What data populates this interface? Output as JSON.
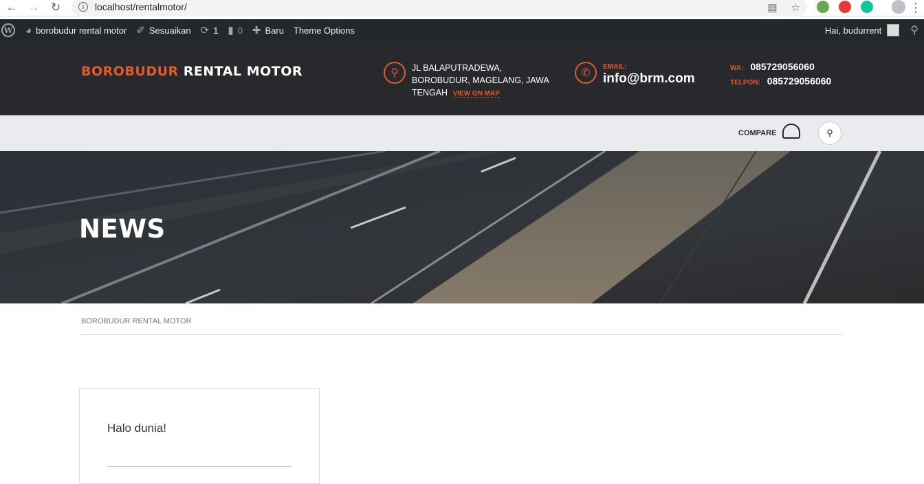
{
  "browser": {
    "url": "localhost/rentalmotor/",
    "back_icon": "arrow-left-icon",
    "forward_icon": "arrow-right-icon",
    "reload_icon": "reload-icon"
  },
  "adminbar": {
    "site_name": "borobudur rental motor",
    "customize": "Sesuaikan",
    "updates_count": "1",
    "comments_count": "0",
    "new_label": "Baru",
    "theme_options": "Theme Options",
    "greeting": "Hai, budurrent"
  },
  "header": {
    "logo_part1": "BOROBUDUR",
    "logo_part2": "RENTAL MOTOR",
    "address": "JL BALAPUTRADEWA, BOROBUDUR, MAGELANG, JAWA TENGAH",
    "view_on_map": "VIEW ON MAP",
    "email_label": "EMAIL:",
    "email": "info@brm.com",
    "wa_label": "WA:",
    "wa": "085729056060",
    "telpon_label": "TELPON:",
    "telpon": "085729056060",
    "accent_color": "#e05a2b"
  },
  "nav": {
    "compare": "COMPARE"
  },
  "hero": {
    "title": "NEWS"
  },
  "breadcrumb": "BOROBUDUR RENTAL MOTOR",
  "posts": [
    {
      "title": "Halo dunia!"
    }
  ]
}
